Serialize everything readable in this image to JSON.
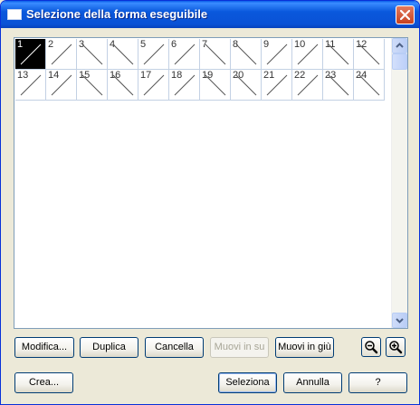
{
  "window": {
    "title": "Selezione della forma eseguibile",
    "icon": "window-icon",
    "close_icon": "close-icon"
  },
  "shapes": {
    "selected": 1,
    "items": [
      {
        "number": "1",
        "stroke": "rising"
      },
      {
        "number": "2",
        "stroke": "rising"
      },
      {
        "number": "3",
        "stroke": "falling"
      },
      {
        "number": "4",
        "stroke": "falling"
      },
      {
        "number": "5",
        "stroke": "rising"
      },
      {
        "number": "6",
        "stroke": "rising"
      },
      {
        "number": "7",
        "stroke": "falling"
      },
      {
        "number": "8",
        "stroke": "falling"
      },
      {
        "number": "9",
        "stroke": "rising"
      },
      {
        "number": "10",
        "stroke": "rising"
      },
      {
        "number": "11",
        "stroke": "falling"
      },
      {
        "number": "12",
        "stroke": "falling"
      },
      {
        "number": "13",
        "stroke": "rising"
      },
      {
        "number": "14",
        "stroke": "rising"
      },
      {
        "number": "15",
        "stroke": "falling"
      },
      {
        "number": "16",
        "stroke": "falling"
      },
      {
        "number": "17",
        "stroke": "rising"
      },
      {
        "number": "18",
        "stroke": "rising"
      },
      {
        "number": "19",
        "stroke": "falling"
      },
      {
        "number": "20",
        "stroke": "falling"
      },
      {
        "number": "21",
        "stroke": "rising"
      },
      {
        "number": "22",
        "stroke": "rising"
      },
      {
        "number": "23",
        "stroke": "falling"
      },
      {
        "number": "24",
        "stroke": "falling"
      }
    ]
  },
  "buttons": {
    "modifica": "Modifica...",
    "duplica": "Duplica",
    "cancella": "Cancella",
    "muovi_su": "Muovi in su",
    "muovi_giu": "Muovi in giù",
    "crea": "Crea...",
    "seleziona": "Seleziona",
    "annulla": "Annulla",
    "help": "?"
  },
  "icons": {
    "zoom_out": "zoom-out-icon",
    "zoom_in": "zoom-in-icon",
    "scroll_up": "scroll-up-icon",
    "scroll_down": "scroll-down-icon"
  },
  "colors": {
    "titlebar": "#0a58dc",
    "close": "#c7411f",
    "selection": "#000000",
    "dialog_bg": "#ece9d8"
  }
}
